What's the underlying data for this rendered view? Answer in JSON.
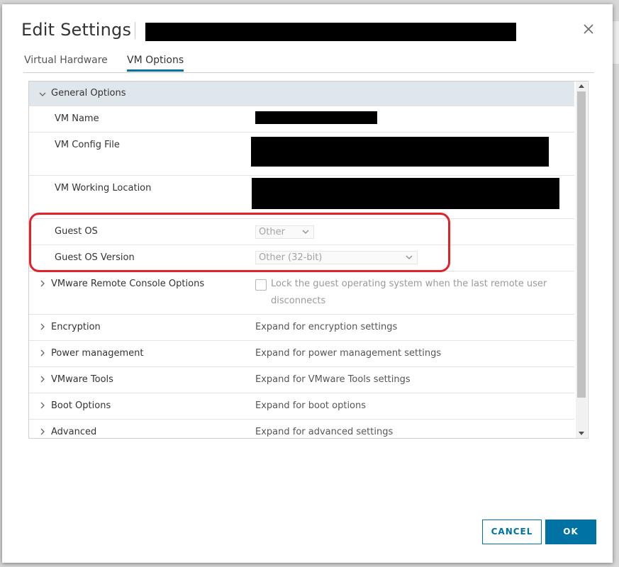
{
  "dialog": {
    "title": "Edit Settings",
    "close_icon": "close-icon"
  },
  "tabs": [
    {
      "label": "Virtual Hardware",
      "active": false
    },
    {
      "label": "VM Options",
      "active": true
    }
  ],
  "general_options": {
    "header": "General Options",
    "vm_name_label": "VM Name",
    "vm_config_file_label": "VM Config File",
    "vm_working_location_label": "VM Working Location",
    "guest_os_label": "Guest OS",
    "guest_os_value": "Other",
    "guest_os_version_label": "Guest OS Version",
    "guest_os_version_value": "Other (32-bit)"
  },
  "remote_console": {
    "label": "VMware Remote Console Options",
    "checkbox_text": "Lock the guest operating system when the last remote user disconnects"
  },
  "sections": [
    {
      "label": "Encryption",
      "value": "Expand for encryption settings"
    },
    {
      "label": "Power management",
      "value": "Expand for power management settings"
    },
    {
      "label": "VMware Tools",
      "value": "Expand for VMware Tools settings"
    },
    {
      "label": "Boot Options",
      "value": "Expand for boot options"
    },
    {
      "label": "Advanced",
      "value": "Expand for advanced settings"
    }
  ],
  "buttons": {
    "cancel": "CANCEL",
    "ok": "OK"
  },
  "colors": {
    "accent": "#0072a3",
    "highlight": "#e0232b",
    "header_bg": "#dfe6ec"
  }
}
